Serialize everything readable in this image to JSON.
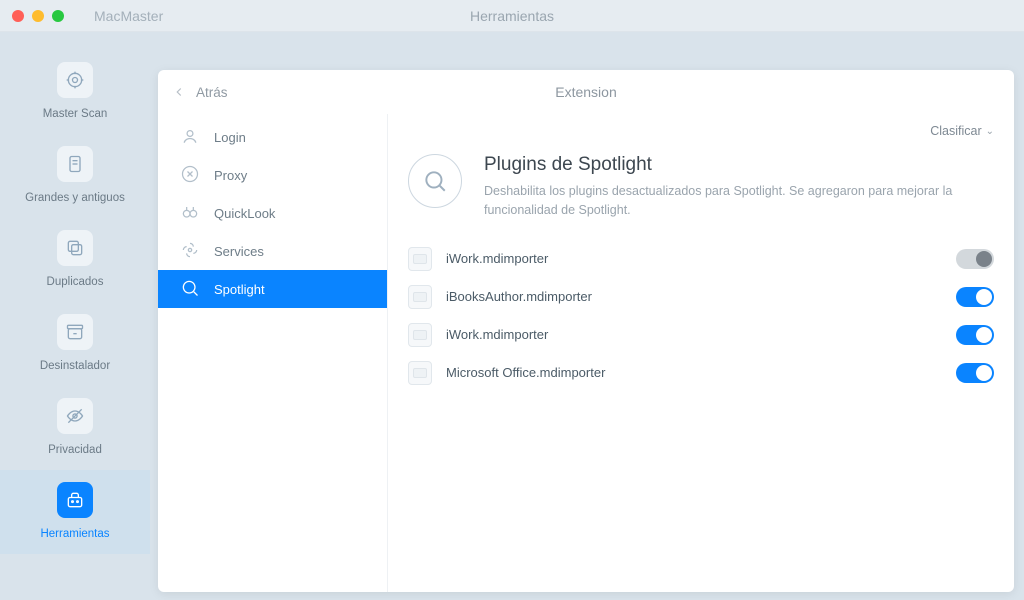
{
  "app_name": "MacMaster",
  "window_title": "Herramientas",
  "sidebar": {
    "items": [
      {
        "label": "Master Scan",
        "icon": "target",
        "active": false
      },
      {
        "label": "Grandes y antiguos",
        "icon": "file",
        "active": false
      },
      {
        "label": "Duplicados",
        "icon": "copy",
        "active": false
      },
      {
        "label": "Desinstalador",
        "icon": "archive",
        "active": false
      },
      {
        "label": "Privacidad",
        "icon": "eye-off",
        "active": false
      },
      {
        "label": "Herramientas",
        "icon": "toolbox",
        "active": true
      }
    ]
  },
  "panel": {
    "back_label": "Atrás",
    "title": "Extension",
    "sort_label": "Clasificar",
    "categories": [
      {
        "label": "Login",
        "icon": "user",
        "active": false
      },
      {
        "label": "Proxy",
        "icon": "x-circle",
        "active": false
      },
      {
        "label": "QuickLook",
        "icon": "binoculars",
        "active": false
      },
      {
        "label": "Services",
        "icon": "fan",
        "active": false
      },
      {
        "label": "Spotlight",
        "icon": "search",
        "active": true
      }
    ],
    "hero": {
      "title": "Plugins de Spotlight",
      "description": "Deshabilita los plugins desactualizados para Spotlight. Se agregaron para mejorar la funcionalidad de Spotlight."
    },
    "plugins": [
      {
        "name": "iWork.mdimporter",
        "enabled": false
      },
      {
        "name": "iBooksAuthor.mdimporter",
        "enabled": true
      },
      {
        "name": "iWork.mdimporter",
        "enabled": true
      },
      {
        "name": "Microsoft Office.mdimporter",
        "enabled": true
      }
    ]
  },
  "colors": {
    "accent": "#0a84ff"
  }
}
